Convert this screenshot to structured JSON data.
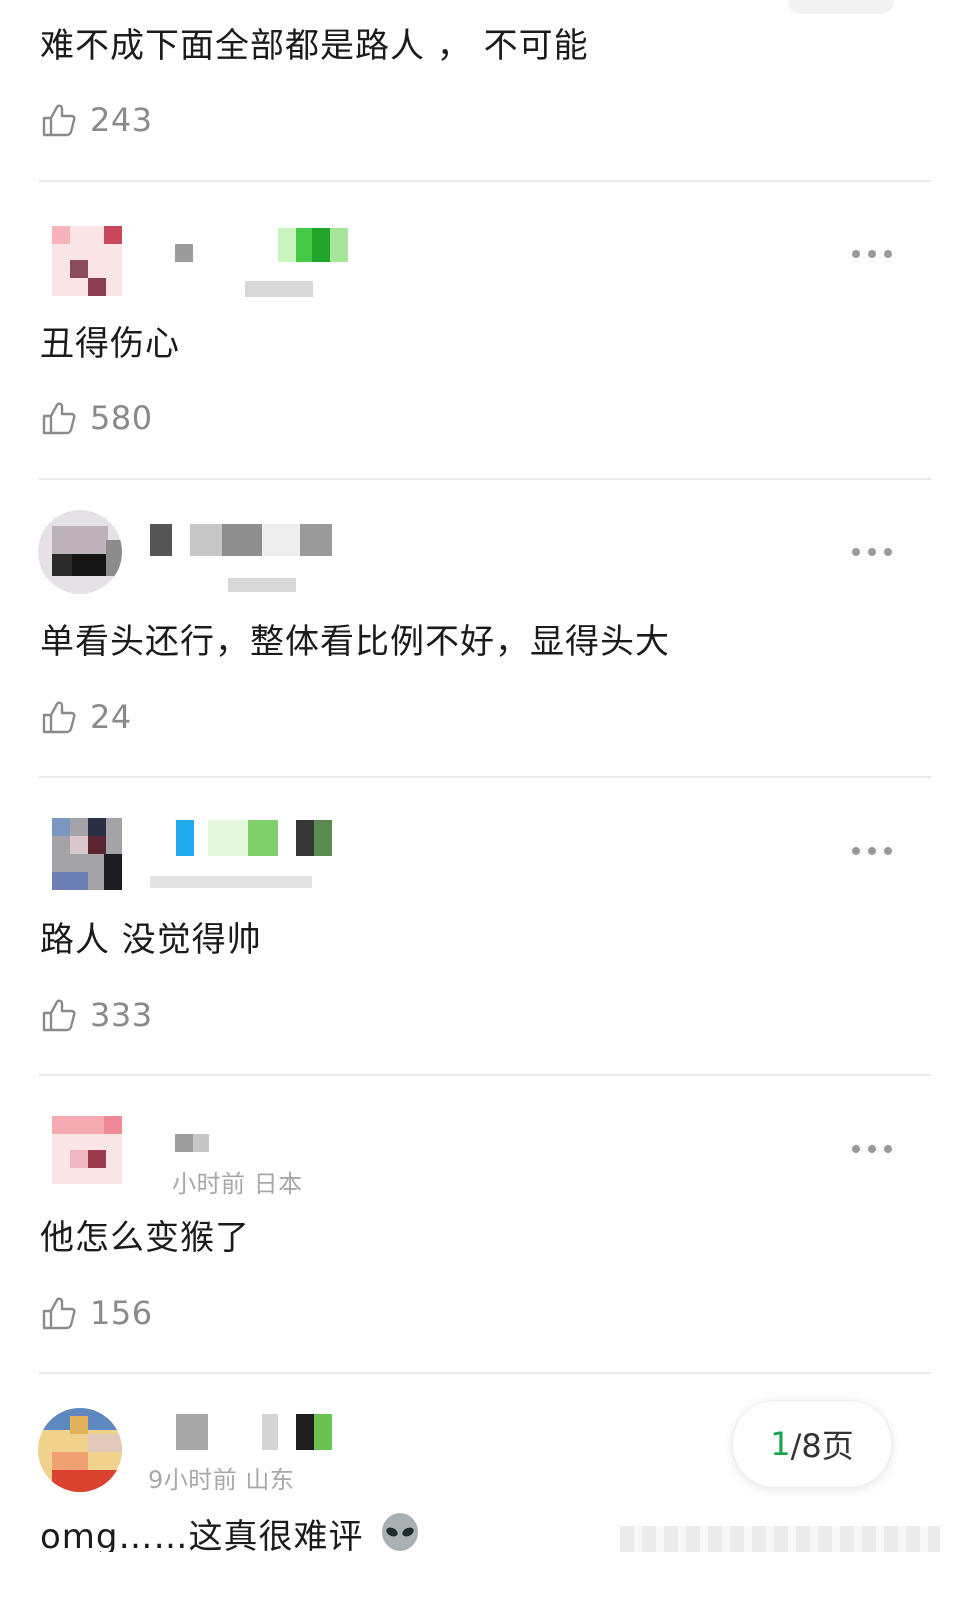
{
  "comments": [
    {
      "text": "难不成下面全部都是路人 ， 不可能",
      "likes": "243"
    },
    {
      "text": "丑得伤心",
      "likes": "580"
    },
    {
      "text": "单看头还行，整体看比例不好，显得头大",
      "likes": "24"
    },
    {
      "text": "路人 没觉得帅",
      "likes": "333"
    },
    {
      "meta": "小时前 日本",
      "text": "他怎么变猴了",
      "likes": "156"
    },
    {
      "meta": "9小时前 山东",
      "text": "omg……这真很难评"
    }
  ],
  "pager": {
    "current": "1",
    "suffix": "/8页"
  },
  "icons": {
    "like": "thumbs-up-icon",
    "more": "more-dots-icon",
    "emoji": "alien-emoji-icon"
  },
  "colors": {
    "accent": "#1aa34a",
    "text": "#1b1b1b",
    "muted": "#8a8a8a",
    "divider": "#e9e9e9"
  }
}
